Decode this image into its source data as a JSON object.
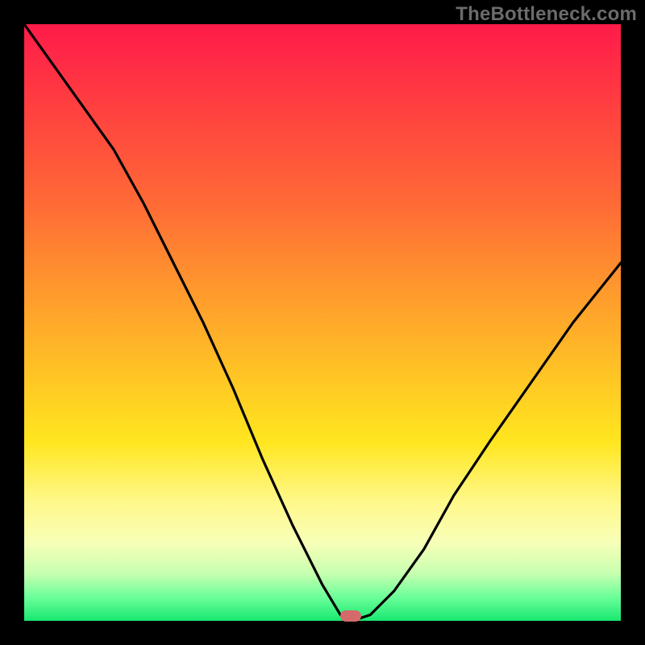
{
  "watermark": "TheBottleneck.com",
  "colors": {
    "frame_bg": "#000000",
    "gradient_top": "#ff1b4a",
    "gradient_bottom": "#18e870",
    "curve": "#000000",
    "marker": "#d46a6a",
    "watermark": "#6b6b6b"
  },
  "chart_data": {
    "type": "line",
    "title": "",
    "xlabel": "",
    "ylabel": "",
    "xlim": [
      0,
      100
    ],
    "ylim": [
      0,
      100
    ],
    "grid": false,
    "series": [
      {
        "name": "bottleneck-curve",
        "x": [
          0,
          5,
          10,
          15,
          20,
          25,
          30,
          35,
          40,
          45,
          50,
          53,
          55,
          58,
          62,
          67,
          72,
          78,
          85,
          92,
          100
        ],
        "values": [
          100,
          93,
          86,
          79,
          70,
          60,
          50,
          39,
          27,
          16,
          6,
          1,
          0,
          1,
          5,
          12,
          21,
          30,
          40,
          50,
          60
        ]
      }
    ],
    "annotations": [
      {
        "name": "sweet-spot-marker",
        "x": 55,
        "y": 0
      }
    ],
    "note": "Values read off the rendered curve in plot-area percent coords (0 = bottom/left, 100 = top/right). No axis ticks or labels are visible in the source image."
  }
}
